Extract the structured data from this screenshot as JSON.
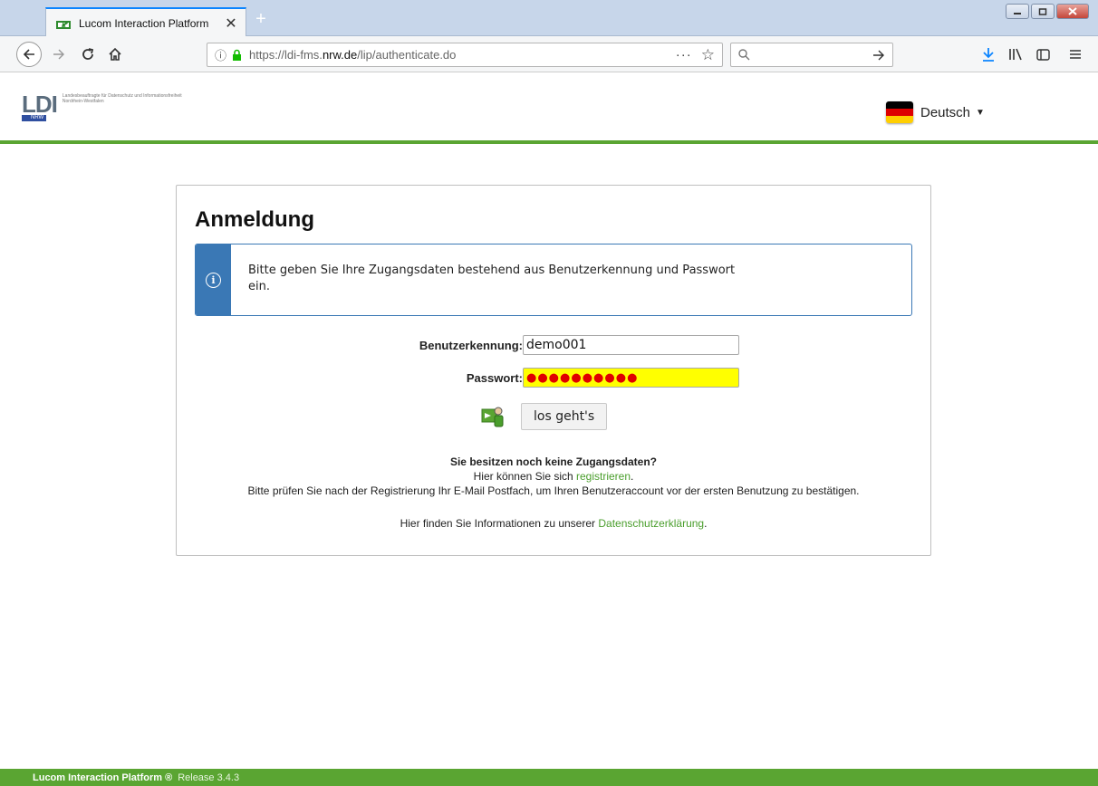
{
  "browser": {
    "tab_title": "Lucom Interaction Platform",
    "tab_close": "✕",
    "new_tab": "+",
    "url_prefix": "https://ldi-fms.",
    "url_host": "nrw.de",
    "url_path": "/lip/authenticate.do",
    "url_more": "···",
    "search_placeholder": ""
  },
  "header": {
    "logo_mark": "LDI",
    "logo_sub": "NRW",
    "logo_text": "Landesbeauftragte für Datenschutz und Informationsfreiheit Nordrhein-Westfalen",
    "language": "Deutsch",
    "flag_colors": [
      "#000000",
      "#dd0000",
      "#ffce00"
    ]
  },
  "login": {
    "title": "Anmeldung",
    "info_text": "Bitte geben Sie Ihre Zugangsdaten bestehend aus Benutzerkennung und Passwort ein.",
    "username_label": "Benutzerkennung:",
    "username_value": "demo001",
    "password_label": "Passwort:",
    "password_value": "●●●●●●●●●●",
    "submit_label": "los geht's"
  },
  "registration": {
    "question": "Sie besitzen noch keine Zugangsdaten?",
    "line1_prefix": "Hier können Sie sich ",
    "line1_link": "registrieren",
    "line1_suffix": ".",
    "line2": "Bitte prüfen Sie nach der Registrierung Ihr E-Mail Postfach, um Ihren Benutzeraccount vor der ersten Benutzung zu bestätigen.",
    "privacy_prefix": "Hier finden Sie Informationen zu unserer ",
    "privacy_link": "Datenschutzerklärung",
    "privacy_suffix": "."
  },
  "footer": {
    "name": "Lucom Interaction Platform ®",
    "release": "Release 3.4.3"
  },
  "colors": {
    "accent_green": "#5aa532",
    "info_blue": "#3a78b5",
    "firefox_blue": "#0a84ff"
  }
}
